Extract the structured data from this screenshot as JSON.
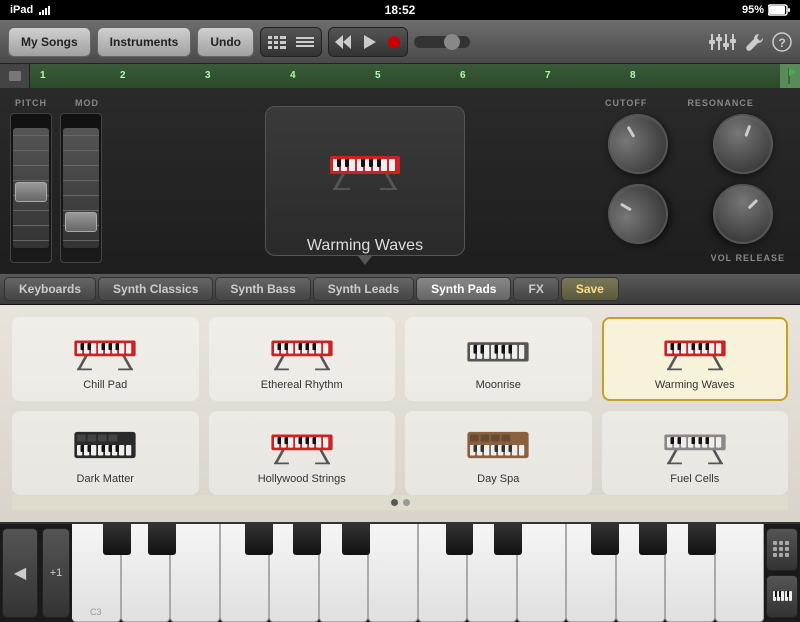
{
  "statusBar": {
    "left": "iPad",
    "time": "18:52",
    "right": "95%"
  },
  "toolbar": {
    "mySongs": "My Songs",
    "instruments": "Instruments",
    "undo": "Undo"
  },
  "rulerMarks": [
    "1",
    "2",
    "3",
    "4",
    "5",
    "6",
    "7",
    "8"
  ],
  "controls": {
    "pitch": "PITCH",
    "mod": "MOD",
    "cutoff": "CUTOFF",
    "resonance": "RESONANCE",
    "volRelease": "VOL RELEASE"
  },
  "currentPreset": "Warming Waves",
  "categories": [
    {
      "id": "keyboards",
      "label": "Keyboards",
      "active": false
    },
    {
      "id": "synth-classics",
      "label": "Synth Classics",
      "active": false
    },
    {
      "id": "synth-bass",
      "label": "Synth Bass",
      "active": false
    },
    {
      "id": "synth-leads",
      "label": "Synth Leads",
      "active": false
    },
    {
      "id": "synth-pads",
      "label": "Synth Pads",
      "active": true
    },
    {
      "id": "fx",
      "label": "FX",
      "active": false
    },
    {
      "id": "save",
      "label": "Save",
      "active": false
    }
  ],
  "presets": [
    {
      "id": "chill-pad",
      "name": "Chill Pad",
      "selected": false,
      "type": "keyboard-stand"
    },
    {
      "id": "ethereal-rhythm",
      "name": "Ethereal Rhythm",
      "selected": false,
      "type": "keyboard-stand"
    },
    {
      "id": "moonrise",
      "name": "Moonrise",
      "selected": false,
      "type": "keyboard-flat"
    },
    {
      "id": "warming-waves",
      "name": "Warming Waves",
      "selected": true,
      "type": "keyboard-stand"
    },
    {
      "id": "dark-matter",
      "name": "Dark Matter",
      "selected": false,
      "type": "synth-flat"
    },
    {
      "id": "hollywood-strings",
      "name": "Hollywood Strings",
      "selected": false,
      "type": "keyboard-stand"
    },
    {
      "id": "day-spa",
      "name": "Day Spa",
      "selected": false,
      "type": "synth-brown"
    },
    {
      "id": "fuel-cells",
      "name": "Fuel Cells",
      "selected": false,
      "type": "keyboard-stand-small"
    }
  ],
  "dots": [
    true,
    false
  ],
  "keyLabel": "C3"
}
